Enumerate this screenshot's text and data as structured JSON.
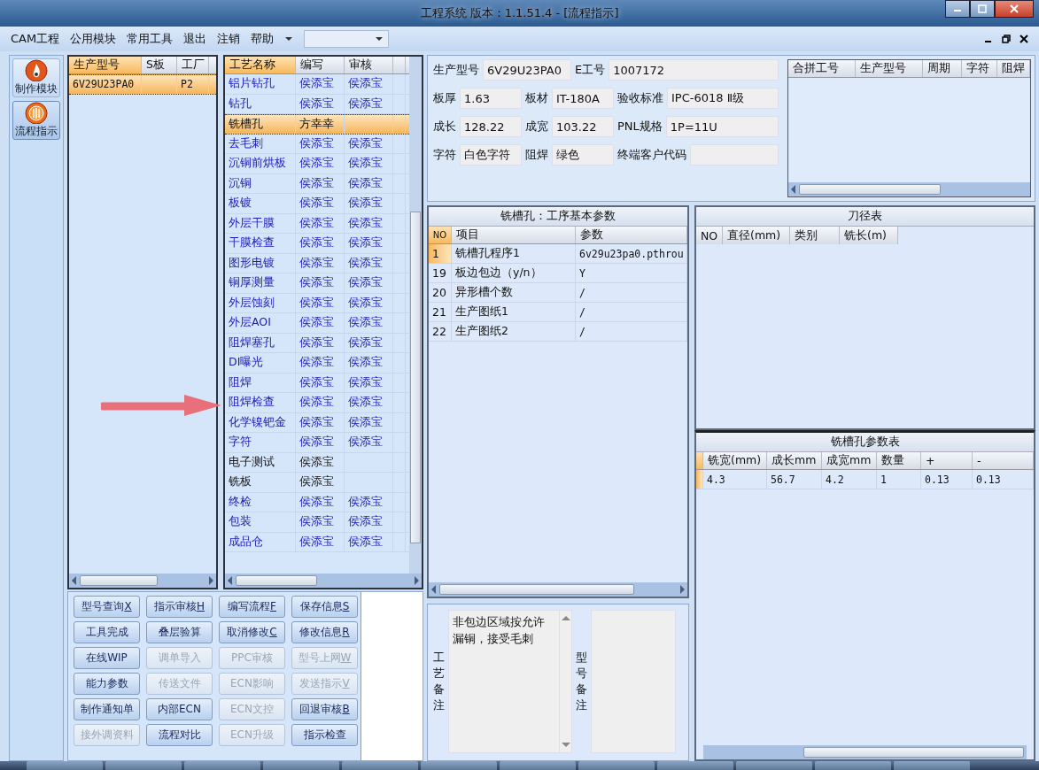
{
  "window": {
    "title": "工程系统   版本：1.1.51.4 - [流程指示]"
  },
  "menu": [
    "CAM工程",
    "公用模块",
    "常用工具",
    "退出",
    "注销",
    "帮助"
  ],
  "sidebar": [
    {
      "label": "制作模块",
      "kind": "fire",
      "selected": false
    },
    {
      "label": "流程指示",
      "kind": "dial",
      "selected": true
    }
  ],
  "products": {
    "columns": [
      "生产型号",
      "S板",
      "工厂"
    ],
    "rows": [
      {
        "cells": [
          "6V29U23PA0",
          "",
          "P2"
        ],
        "selected": true
      }
    ]
  },
  "process": {
    "columns": [
      "工艺名称",
      "编写",
      "审核"
    ],
    "rows": [
      {
        "cells": [
          "铝片钻孔",
          "侯添宝",
          "侯添宝"
        ],
        "approved": true,
        "selected": false
      },
      {
        "cells": [
          "钻孔",
          "侯添宝",
          "侯添宝"
        ],
        "approved": true,
        "selected": false
      },
      {
        "cells": [
          "铣槽孔",
          "方幸幸",
          ""
        ],
        "approved": false,
        "selected": true
      },
      {
        "cells": [
          "去毛刺",
          "侯添宝",
          "侯添宝"
        ],
        "approved": true,
        "selected": false
      },
      {
        "cells": [
          "沉铜前烘板",
          "侯添宝",
          "侯添宝"
        ],
        "approved": true,
        "selected": false
      },
      {
        "cells": [
          "沉铜",
          "侯添宝",
          "侯添宝"
        ],
        "approved": true,
        "selected": false
      },
      {
        "cells": [
          "板镀",
          "侯添宝",
          "侯添宝"
        ],
        "approved": true,
        "selected": false
      },
      {
        "cells": [
          "外层干膜",
          "侯添宝",
          "侯添宝"
        ],
        "approved": true,
        "selected": false
      },
      {
        "cells": [
          "干膜检查",
          "侯添宝",
          "侯添宝"
        ],
        "approved": true,
        "selected": false
      },
      {
        "cells": [
          "图形电镀",
          "侯添宝",
          "侯添宝"
        ],
        "approved": true,
        "selected": false
      },
      {
        "cells": [
          "铜厚测量",
          "侯添宝",
          "侯添宝"
        ],
        "approved": true,
        "selected": false
      },
      {
        "cells": [
          "外层蚀刻",
          "侯添宝",
          "侯添宝"
        ],
        "approved": true,
        "selected": false
      },
      {
        "cells": [
          "外层AOI",
          "侯添宝",
          "侯添宝"
        ],
        "approved": true,
        "selected": false
      },
      {
        "cells": [
          "阻焊塞孔",
          "侯添宝",
          "侯添宝"
        ],
        "approved": true,
        "selected": false
      },
      {
        "cells": [
          "DI曝光",
          "侯添宝",
          "侯添宝"
        ],
        "approved": true,
        "selected": false
      },
      {
        "cells": [
          "阻焊",
          "侯添宝",
          "侯添宝"
        ],
        "approved": true,
        "selected": false
      },
      {
        "cells": [
          "阻焊检查",
          "侯添宝",
          "侯添宝"
        ],
        "approved": true,
        "selected": false
      },
      {
        "cells": [
          "化学镍钯金",
          "侯添宝",
          "侯添宝"
        ],
        "approved": true,
        "selected": false
      },
      {
        "cells": [
          "字符",
          "侯添宝",
          "侯添宝"
        ],
        "approved": true,
        "selected": false
      },
      {
        "cells": [
          "电子测试",
          "侯添宝",
          ""
        ],
        "approved": false,
        "selected": false
      },
      {
        "cells": [
          "铣板",
          "侯添宝",
          ""
        ],
        "approved": false,
        "selected": false
      },
      {
        "cells": [
          "终检",
          "侯添宝",
          "侯添宝"
        ],
        "approved": true,
        "selected": false
      },
      {
        "cells": [
          "包装",
          "侯添宝",
          "侯添宝"
        ],
        "approved": true,
        "selected": false
      },
      {
        "cells": [
          "成品仓",
          "侯添宝",
          "侯添宝"
        ],
        "approved": true,
        "selected": false
      }
    ]
  },
  "buttons": [
    {
      "label": "型号查询",
      "hotkey": "X",
      "disabled": false
    },
    {
      "label": "指示审核",
      "hotkey": "H",
      "disabled": false
    },
    {
      "label": "编写流程",
      "hotkey": "F",
      "disabled": false
    },
    {
      "label": "保存信息",
      "hotkey": "S",
      "disabled": false
    },
    {
      "label": "工具完成",
      "disabled": false
    },
    {
      "label": "叠层验算",
      "disabled": false
    },
    {
      "label": "取消修改",
      "hotkey": "C",
      "disabled": false
    },
    {
      "label": "修改信息",
      "hotkey": "R",
      "disabled": false
    },
    {
      "label": "在线WIP",
      "disabled": false
    },
    {
      "label": "调单导入",
      "disabled": true
    },
    {
      "label": "PPC审核",
      "disabled": true
    },
    {
      "label": "型号上网",
      "hotkey": "W",
      "disabled": true
    },
    {
      "label": "能力参数",
      "disabled": false
    },
    {
      "label": "传送文件",
      "disabled": true
    },
    {
      "label": "ECN影响",
      "disabled": true
    },
    {
      "label": "发送指示",
      "hotkey": "V",
      "disabled": true
    },
    {
      "label": "制作通知单",
      "disabled": false
    },
    {
      "label": "内部ECN",
      "disabled": false
    },
    {
      "label": "ECN文控",
      "disabled": true
    },
    {
      "label": "回退审核",
      "hotkey": "B",
      "disabled": false
    },
    {
      "label": "接外调资料",
      "disabled": true
    },
    {
      "label": "流程对比",
      "disabled": false
    },
    {
      "label": "ECN升级",
      "disabled": true
    },
    {
      "label": "指示检查",
      "disabled": false
    }
  ],
  "info": [
    [
      {
        "label": "生产型号",
        "value": "6V29U23PA0",
        "wide": true
      },
      {
        "label": "E工号",
        "value": "1007172"
      }
    ],
    [
      {
        "label": "板厚",
        "value": "1.63"
      },
      {
        "label": "板材",
        "value": "IT-180A"
      },
      {
        "label": "验收标准",
        "value": "IPC-6018 Ⅱ级"
      }
    ],
    [
      {
        "label": "成长",
        "value": "128.22"
      },
      {
        "label": "成宽",
        "value": "103.22"
      },
      {
        "label": "PNL规格",
        "value": "1P=11U"
      }
    ],
    [
      {
        "label": "字符",
        "value": "白色字符"
      },
      {
        "label": "阻焊",
        "value": "绿色"
      },
      {
        "label": "终端客户代码"
      }
    ]
  ],
  "merge_table": {
    "columns": [
      "合拼工号",
      "生产型号",
      "周期",
      "字符",
      "阻焊"
    ]
  },
  "params": {
    "title": "铣槽孔：工序基本参数",
    "columns": [
      "NO",
      "项目",
      "参数"
    ],
    "rows": [
      {
        "cells": [
          "1",
          "铣槽孔程序1",
          "6v29u23pa0.pthrou"
        ],
        "selected": true
      },
      {
        "cells": [
          "19",
          "板边包边（y/n）",
          "Y"
        ],
        "selected": false
      },
      {
        "cells": [
          "20",
          "异形槽个数",
          "/"
        ],
        "selected": false
      },
      {
        "cells": [
          "21",
          "生产图纸1",
          "/"
        ],
        "selected": false
      },
      {
        "cells": [
          "22",
          "生产图纸2",
          "/"
        ],
        "selected": false
      }
    ]
  },
  "tools": {
    "title": "刀径表",
    "columns": [
      "NO",
      "直径(mm)",
      "类别",
      "铣长(m)"
    ]
  },
  "slot_params": {
    "title": "铣槽孔参数表",
    "columns": [
      "铣宽(mm)",
      "成长mm",
      "成宽mm",
      "数量",
      "+",
      "-"
    ],
    "rows": [
      {
        "cells": [
          "4.3",
          "56.7",
          "4.2",
          "1",
          "0.13",
          "0.13"
        ]
      }
    ]
  },
  "notes": [
    {
      "label": "工艺备注",
      "value": "非包边区域按允许漏铜，接受毛刺"
    },
    {
      "label": "型号备注"
    }
  ]
}
